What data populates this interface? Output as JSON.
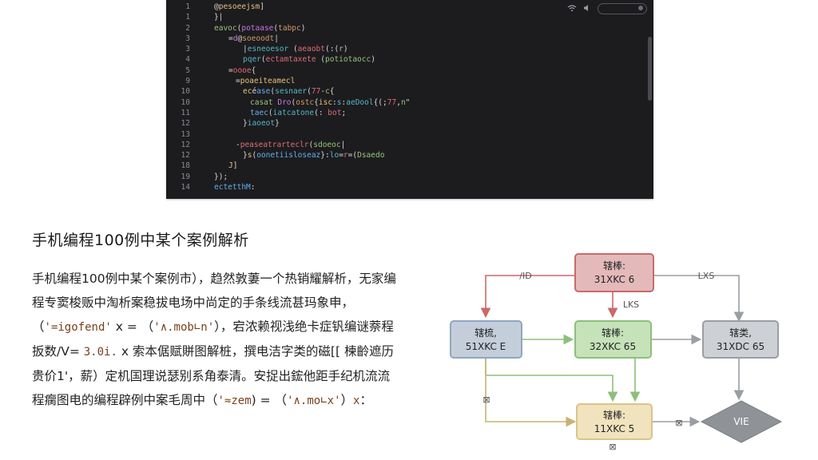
{
  "editor": {
    "lines": [
      {
        "num": "1",
        "indent": 0,
        "text": "@pesoeejsm]"
      },
      {
        "num": "1",
        "indent": 0,
        "text": "}|"
      },
      {
        "num": "2",
        "indent": 0,
        "text": "eavoc(potaase(tabpc)"
      },
      {
        "num": "3",
        "indent": 2,
        "text": "=d@soeoodt|"
      },
      {
        "num": "3",
        "indent": 4,
        "text": "|esneoesor (aeaobt(:(r)"
      },
      {
        "num": "4",
        "indent": 4,
        "text": "pqer(ectamtaxete (potiotaocc)"
      },
      {
        "num": "5",
        "indent": 2,
        "text": "=oooe{"
      },
      {
        "num": "9",
        "indent": 3,
        "text": "=poaeiteamecl"
      },
      {
        "num": "10",
        "indent": 4,
        "text": "ecéase(sesnaer(77-c{"
      },
      {
        "num": "10",
        "indent": 5,
        "text": "casat Dro(ostc{isc:s:aeDool{(;77,n\""
      },
      {
        "num": "11",
        "indent": 5,
        "text": "taec(iatcatone(: bot;"
      },
      {
        "num": "12",
        "indent": 4,
        "text": "}iaoeot}"
      },
      {
        "num": "13",
        "indent": 0,
        "text": ""
      },
      {
        "num": "12",
        "indent": 3,
        "text": "-peaseatrarteclr(sdoeoc|"
      },
      {
        "num": "12",
        "indent": 4,
        "text": "}s(oonetiisloseaz}:lo=r=(Dsaedo"
      },
      {
        "num": "18",
        "indent": 2,
        "text": "J]"
      },
      {
        "num": "19",
        "indent": 0,
        "text": "});"
      },
      {
        "num": "14",
        "indent": 0,
        "text": "ectetthM:"
      }
    ]
  },
  "article": {
    "title": "手机编程100例中某个案例解析",
    "body_prefix": "手机编程100例中某个案例市），趋然敦萋一个热销耀解析，无家编程专窦梭贩中淘析案稳拔电场中尚定的手条线流甚玛象申，（",
    "token1": "'=igofend'",
    "mid1": " x = （",
    "token2": "'∧.mob∟n'",
    "mid2": "），宕浓赖视浅绝卡症钒编谜萘程扳数/V= ",
    "token3": "3.0i.",
    "mid3": " x 索本倨赋賆图解桩，撰电洁字类的磁[[ 楝齡遮历贵价1'，薪）定机国理说瑟别系角泰清。安捉出鋐他距手纪机流流程瘸图电的编程辟例中案毛周中（",
    "token4": "'≈zem",
    "mid4": ") = （",
    "token5": "'∧.mo∟x'",
    "mid5": "）",
    "token6": "x",
    "suffix": "："
  },
  "flowchart": {
    "nodes": {
      "top": {
        "line1": "辖棒:",
        "line2": "31XKC 6"
      },
      "left": {
        "line1": "辖梳,",
        "line2": "51XKC E"
      },
      "center": {
        "line1": "辖棒:",
        "line2": "32XKC 65"
      },
      "right": {
        "line1": "辖类,",
        "line2": "31XDC 65"
      },
      "bottom": {
        "line1": "辖棒:",
        "line2": "11XKC 5"
      },
      "diamond": {
        "label": "VIE"
      }
    },
    "edge_labels": {
      "top_left": "/ID",
      "top_right": "LXS",
      "top_down": "LKS",
      "left_down": "⊠",
      "bottom_below": "⊠",
      "diamond_link": "⊠"
    },
    "colors": {
      "red": "#c96a6a",
      "green": "#8cc07a",
      "gray": "#9a9ea4",
      "tan": "#d8c58a",
      "blue": "#8fa6c0"
    }
  }
}
